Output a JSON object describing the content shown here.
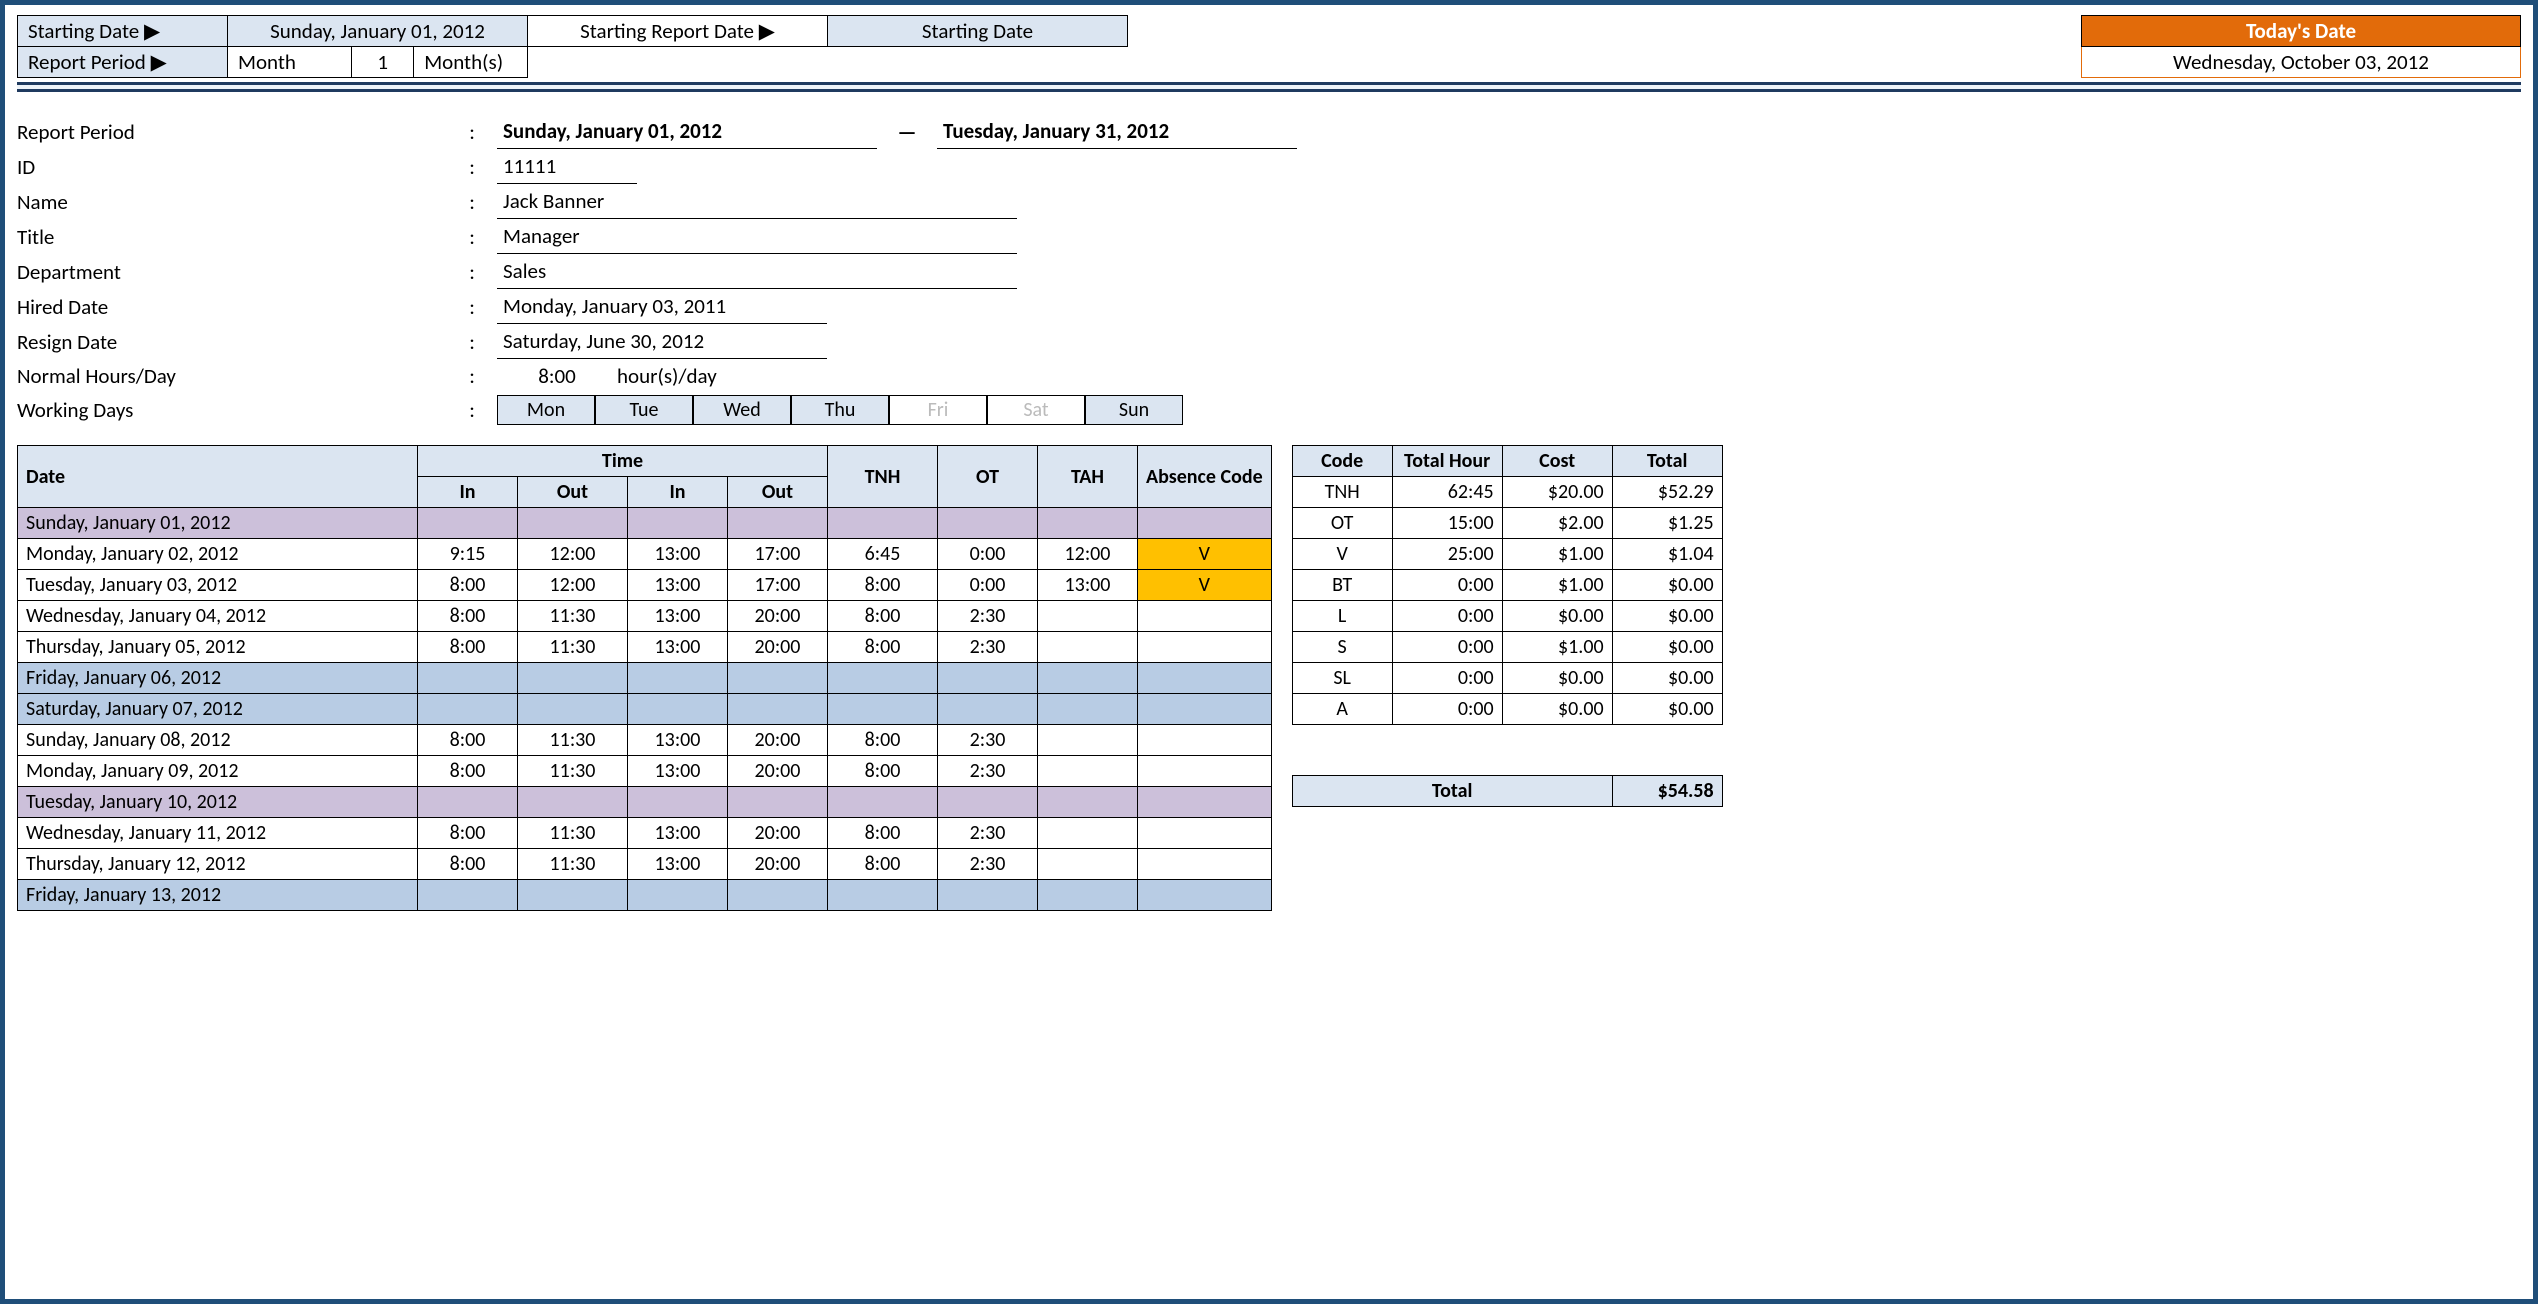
{
  "controls": {
    "starting_date_label": "Starting Date ▶",
    "starting_date_value": "Sunday, January 01, 2012",
    "starting_report_date_label": "Starting Report Date ▶",
    "starting_date_text": "Starting Date",
    "report_period_label": "Report Period ▶",
    "period_unit": "Month",
    "period_qty": "1",
    "period_units": "Month(s)",
    "todays_date_label": "Today's Date",
    "todays_date_value": "Wednesday, October 03, 2012"
  },
  "info": {
    "report_period_label": "Report Period",
    "report_period_start": "Sunday, January 01, 2012",
    "report_period_end": "Tuesday, January 31, 2012",
    "dash": "—",
    "id_label": "ID",
    "id": "11111",
    "name_label": "Name",
    "name": "Jack Banner",
    "title_label": "Title",
    "title": "Manager",
    "department_label": "Department",
    "department": "Sales",
    "hired_label": "Hired Date",
    "hired": "Monday, January 03, 2011",
    "resign_label": "Resign Date",
    "resign": "Saturday, June 30, 2012",
    "normal_hours_label": "Normal Hours/Day",
    "normal_hours": "8:00",
    "normal_hours_unit": "hour(s)/day",
    "working_days_label": "Working Days",
    "days": [
      "Mon",
      "Tue",
      "Wed",
      "Thu",
      "Fri",
      "Sat",
      "Sun"
    ],
    "days_on": [
      true,
      true,
      true,
      true,
      false,
      false,
      true
    ]
  },
  "main": {
    "headers": {
      "date": "Date",
      "time": "Time",
      "in": "In",
      "out": "Out",
      "tnh": "TNH",
      "ot": "OT",
      "tah": "TAH",
      "abs": "Absence Code"
    },
    "rows": [
      {
        "date": "Sunday, January 01, 2012",
        "class": "row-purple",
        "in1": "",
        "out1": "",
        "in2": "",
        "out2": "",
        "tnh": "",
        "ot": "",
        "tah": "",
        "code": ""
      },
      {
        "date": "Monday, January 02, 2012",
        "class": "",
        "in1": "9:15",
        "out1": "12:00",
        "in2": "13:00",
        "out2": "17:00",
        "tnh": "6:45",
        "ot": "0:00",
        "tah": "12:00",
        "code": "V"
      },
      {
        "date": "Tuesday, January 03, 2012",
        "class": "",
        "in1": "8:00",
        "out1": "12:00",
        "in2": "13:00",
        "out2": "17:00",
        "tnh": "8:00",
        "ot": "0:00",
        "tah": "13:00",
        "code": "V"
      },
      {
        "date": "Wednesday, January 04, 2012",
        "class": "",
        "in1": "8:00",
        "out1": "11:30",
        "in2": "13:00",
        "out2": "20:00",
        "tnh": "8:00",
        "ot": "2:30",
        "tah": "",
        "code": ""
      },
      {
        "date": "Thursday, January 05, 2012",
        "class": "",
        "in1": "8:00",
        "out1": "11:30",
        "in2": "13:00",
        "out2": "20:00",
        "tnh": "8:00",
        "ot": "2:30",
        "tah": "",
        "code": ""
      },
      {
        "date": "Friday, January 06, 2012",
        "class": "row-blue",
        "in1": "",
        "out1": "",
        "in2": "",
        "out2": "",
        "tnh": "",
        "ot": "",
        "tah": "",
        "code": ""
      },
      {
        "date": "Saturday, January 07, 2012",
        "class": "row-blue",
        "in1": "",
        "out1": "",
        "in2": "",
        "out2": "",
        "tnh": "",
        "ot": "",
        "tah": "",
        "code": ""
      },
      {
        "date": "Sunday, January 08, 2012",
        "class": "",
        "in1": "8:00",
        "out1": "11:30",
        "in2": "13:00",
        "out2": "20:00",
        "tnh": "8:00",
        "ot": "2:30",
        "tah": "",
        "code": ""
      },
      {
        "date": "Monday, January 09, 2012",
        "class": "",
        "in1": "8:00",
        "out1": "11:30",
        "in2": "13:00",
        "out2": "20:00",
        "tnh": "8:00",
        "ot": "2:30",
        "tah": "",
        "code": ""
      },
      {
        "date": "Tuesday, January 10, 2012",
        "class": "row-purple",
        "in1": "",
        "out1": "",
        "in2": "",
        "out2": "",
        "tnh": "",
        "ot": "",
        "tah": "",
        "code": ""
      },
      {
        "date": "Wednesday, January 11, 2012",
        "class": "",
        "in1": "8:00",
        "out1": "11:30",
        "in2": "13:00",
        "out2": "20:00",
        "tnh": "8:00",
        "ot": "2:30",
        "tah": "",
        "code": ""
      },
      {
        "date": "Thursday, January 12, 2012",
        "class": "",
        "in1": "8:00",
        "out1": "11:30",
        "in2": "13:00",
        "out2": "20:00",
        "tnh": "8:00",
        "ot": "2:30",
        "tah": "",
        "code": ""
      },
      {
        "date": "Friday, January 13, 2012",
        "class": "row-blue",
        "in1": "",
        "out1": "",
        "in2": "",
        "out2": "",
        "tnh": "",
        "ot": "",
        "tah": "",
        "code": ""
      }
    ]
  },
  "summary": {
    "headers": {
      "code": "Code",
      "total_hour": "Total Hour",
      "cost": "Cost",
      "total": "Total"
    },
    "rows": [
      {
        "code": "TNH",
        "hour": "62:45",
        "cost": "$20.00",
        "total": "$52.29"
      },
      {
        "code": "OT",
        "hour": "15:00",
        "cost": "$2.00",
        "total": "$1.25"
      },
      {
        "code": "V",
        "hour": "25:00",
        "cost": "$1.00",
        "total": "$1.04"
      },
      {
        "code": "BT",
        "hour": "0:00",
        "cost": "$1.00",
        "total": "$0.00"
      },
      {
        "code": "L",
        "hour": "0:00",
        "cost": "$0.00",
        "total": "$0.00"
      },
      {
        "code": "S",
        "hour": "0:00",
        "cost": "$1.00",
        "total": "$0.00"
      },
      {
        "code": "SL",
        "hour": "0:00",
        "cost": "$0.00",
        "total": "$0.00"
      },
      {
        "code": "A",
        "hour": "0:00",
        "cost": "$0.00",
        "total": "$0.00"
      }
    ],
    "grand_label": "Total",
    "grand_total": "$54.58"
  }
}
